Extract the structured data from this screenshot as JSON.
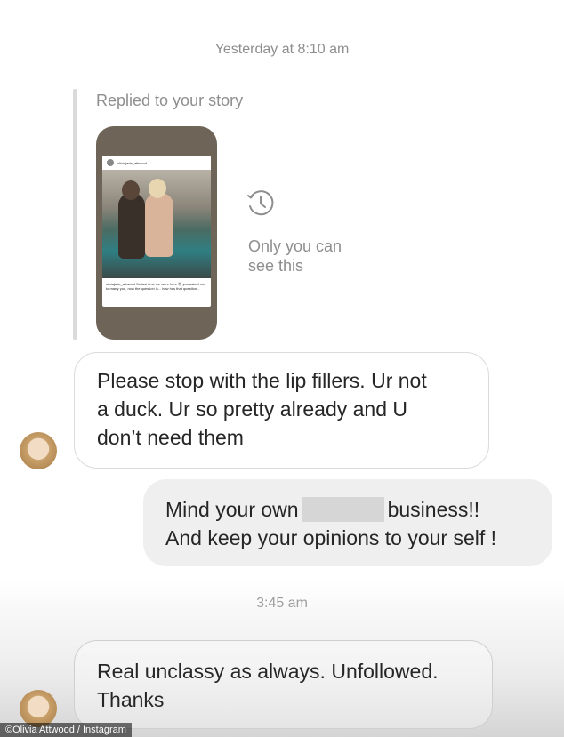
{
  "thread": {
    "timestamp_1": "Yesterday at 8:10 am",
    "timestamp_2": "3:45 am"
  },
  "story_reply": {
    "label": "Replied to your story",
    "only_you_line1": "Only you can",
    "only_you_line2": "see this",
    "icon": "history-icon",
    "post_username": "oliviajade_attwood",
    "post_caption": "oliviajade_attwood So last time we were here 😍 you asked me to marry you, now the question is... how has that question..."
  },
  "messages": [
    {
      "id": "m1",
      "direction": "incoming",
      "lines": [
        "Please stop with the lip fillers. Ur not",
        "a duck. Ur so pretty already and U",
        "don’t need them"
      ]
    },
    {
      "id": "m2",
      "direction": "outgoing",
      "line1_before": "Mind your own",
      "line1_after": "business!!",
      "line2": "And keep your opinions to your self !"
    },
    {
      "id": "m3",
      "direction": "incoming",
      "lines": [
        "Real unclassy as always. Unfollowed.",
        "Thanks"
      ]
    }
  ],
  "credit": "©Olivia Attwood / Instagram",
  "colors": {
    "meta_text": "#8e8e8e",
    "incoming_border": "#dbdbdb",
    "outgoing_bg": "#efefef"
  }
}
